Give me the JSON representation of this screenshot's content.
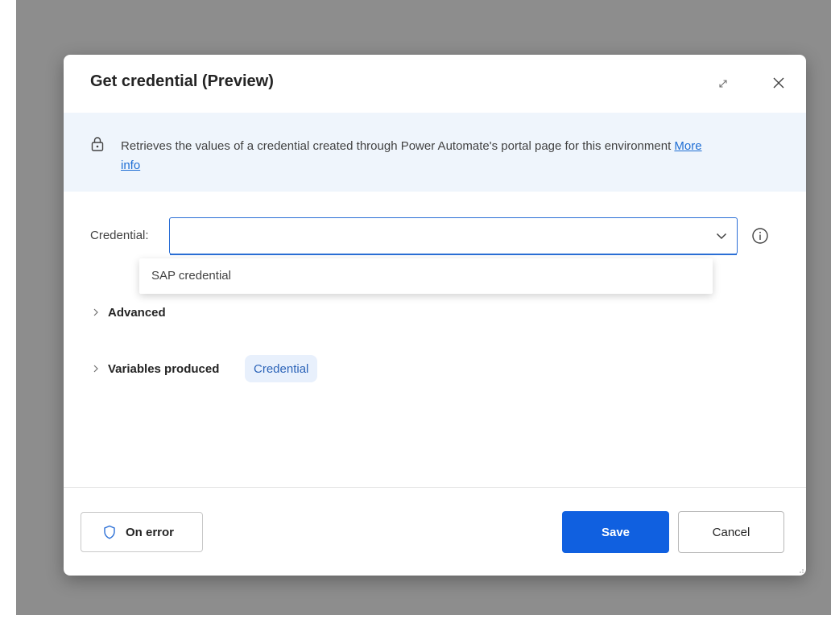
{
  "dialog": {
    "title": "Get credential (Preview)",
    "expand_icon": "expand-diagonal-icon",
    "close_icon": "close-icon"
  },
  "banner": {
    "icon": "lock-icon",
    "text": "Retrieves the values of a credential created through Power Automate's portal page for this environment ",
    "link_text": "More info"
  },
  "credential": {
    "label": "Credential:",
    "value": "",
    "dropdown_icon": "chevron-down-icon",
    "info_icon": "info-icon",
    "options": [
      "SAP credential"
    ]
  },
  "sections": {
    "advanced_label": "Advanced",
    "variables_label": "Variables produced",
    "variables": [
      "Credential"
    ]
  },
  "footer": {
    "on_error_label": "On error",
    "on_error_icon": "shield-icon",
    "save_label": "Save",
    "cancel_label": "Cancel"
  },
  "colors": {
    "accent": "#1060e0",
    "banner_bg": "#eff5fc",
    "chip_bg": "#e8f0fc",
    "backdrop": "#8d8d8d"
  }
}
